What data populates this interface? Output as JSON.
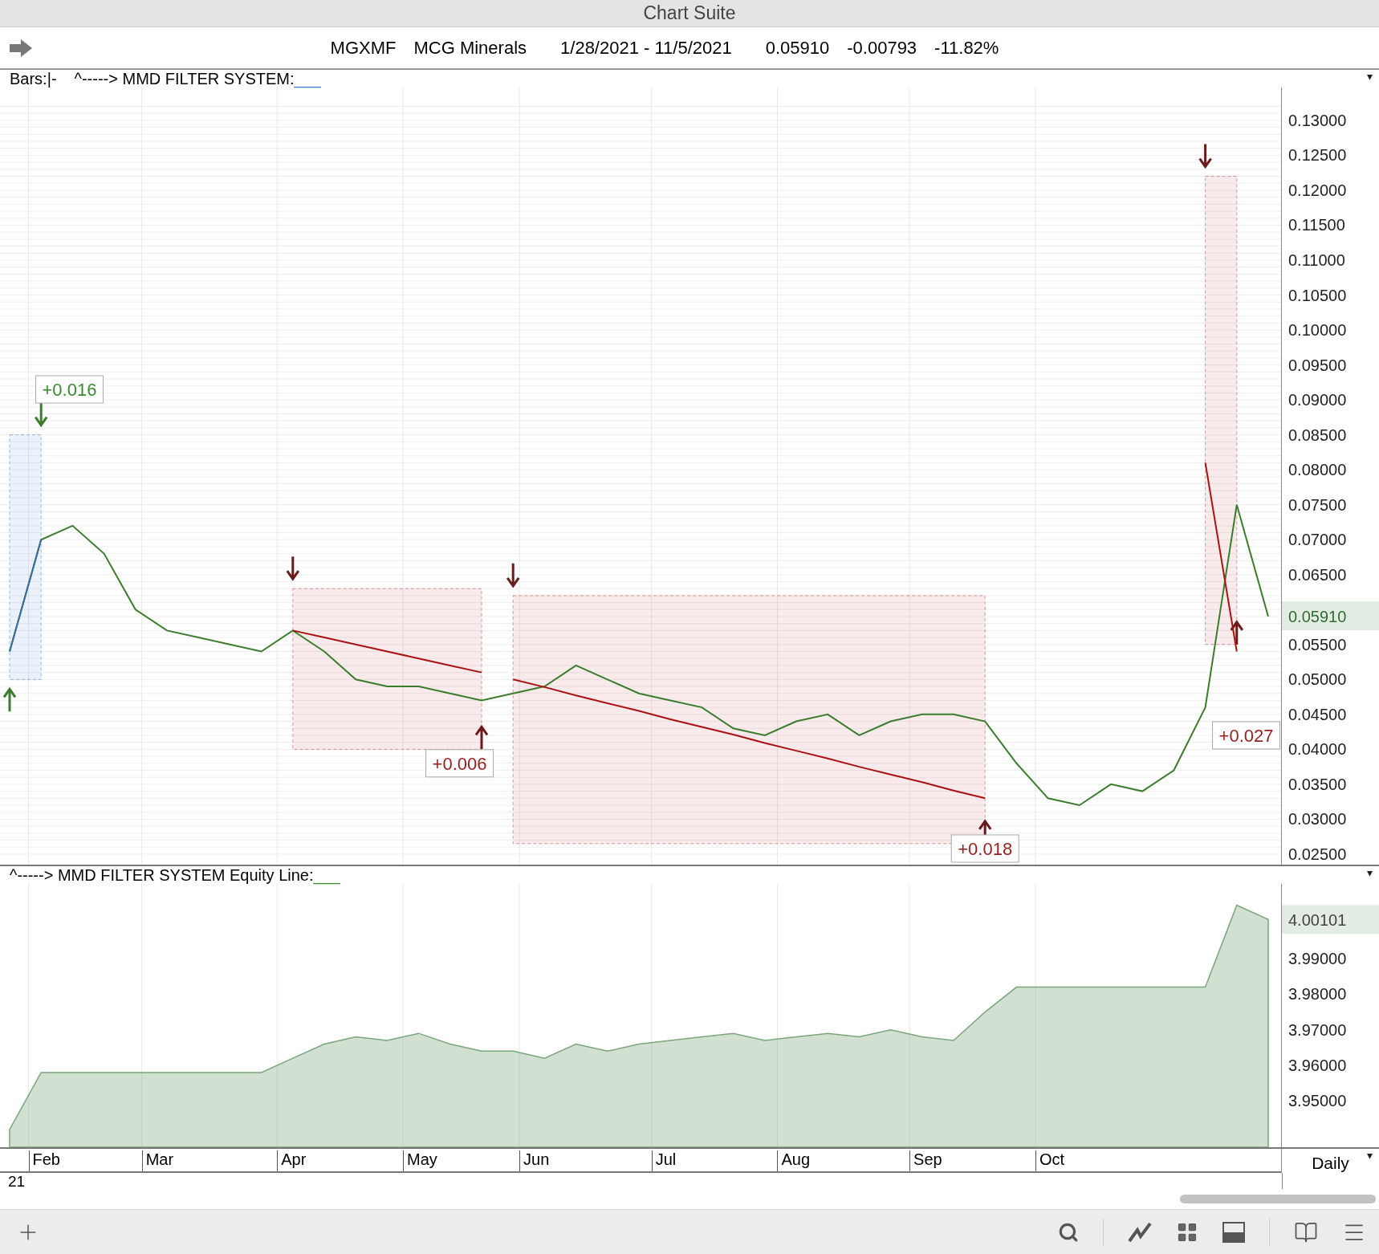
{
  "window": {
    "title": "Chart Suite"
  },
  "header": {
    "symbol": "MGXMF",
    "company": "MCG Minerals",
    "date_range": "1/28/2021 - 11/5/2021",
    "last": "0.05910",
    "change": "-0.00793",
    "change_pct": "-11.82%"
  },
  "price_pane": {
    "legend": {
      "bars_label": "Bars:",
      "bars_style": "|-",
      "system": "^-----> MMD FILTER SYSTEM:",
      "swatch": "___"
    },
    "menu_glyph": "▾",
    "current_value": "0.05910",
    "chart_data": {
      "type": "line",
      "grid": true,
      "series": [
        {
          "color": "#3a7d2c",
          "values": [
            0.054,
            0.07,
            0.072,
            0.068,
            0.06,
            0.057,
            0.056,
            0.055,
            0.054,
            0.057,
            0.054,
            0.05,
            0.049,
            0.049,
            0.048,
            0.047,
            0.048,
            0.049,
            0.052,
            0.05,
            0.048,
            0.047,
            0.046,
            0.043,
            0.042,
            0.044,
            0.045,
            0.042,
            0.044,
            0.045,
            0.045,
            0.044,
            0.038,
            0.033,
            0.032,
            0.035,
            0.034,
            0.037,
            0.046,
            0.075,
            0.059
          ]
        },
        {
          "color": "#3b6fa8",
          "values": [
            0.054,
            0.07,
            null,
            null,
            null,
            null,
            null,
            null,
            null,
            null,
            null,
            null,
            null,
            null,
            null,
            null,
            null,
            null,
            null,
            null,
            null,
            null,
            null,
            null,
            null,
            null,
            null,
            null,
            null,
            null,
            null,
            null,
            null,
            null,
            null,
            null,
            null,
            null,
            null,
            null,
            null
          ]
        },
        {
          "color": "#aa1111",
          "values": [
            null,
            null,
            null,
            null,
            null,
            null,
            null,
            null,
            null,
            0.057,
            0.056,
            0.055,
            0.054,
            0.053,
            0.052,
            0.051,
            null,
            null,
            null,
            null,
            null,
            null,
            null,
            null,
            null,
            null,
            null,
            null,
            null,
            null,
            null,
            null,
            null,
            null,
            null,
            null,
            null,
            null,
            null,
            null,
            null
          ]
        },
        {
          "color": "#aa1111",
          "values": [
            null,
            null,
            null,
            null,
            null,
            null,
            null,
            null,
            null,
            null,
            null,
            null,
            null,
            null,
            null,
            null,
            0.05,
            0.0489,
            0.0477,
            0.0466,
            0.0455,
            0.0443,
            0.0432,
            0.0421,
            0.0409,
            0.0398,
            0.0387,
            0.0375,
            0.0364,
            0.0353,
            0.0341,
            0.033,
            null,
            null,
            null,
            null,
            null,
            null,
            null,
            null,
            null
          ]
        },
        {
          "color": "#aa1111",
          "values": [
            null,
            null,
            null,
            null,
            null,
            null,
            null,
            null,
            null,
            null,
            null,
            null,
            null,
            null,
            null,
            null,
            null,
            null,
            null,
            null,
            null,
            null,
            null,
            null,
            null,
            null,
            null,
            null,
            null,
            null,
            null,
            null,
            null,
            null,
            null,
            null,
            null,
            null,
            0.081,
            0.054,
            null
          ]
        }
      ],
      "ylim": [
        0.0235,
        0.1347
      ],
      "yticks": [
        {
          "value": 0.025,
          "label": "0.02500"
        },
        {
          "value": 0.03,
          "label": "0.03000"
        },
        {
          "value": 0.035,
          "label": "0.03500"
        },
        {
          "value": 0.04,
          "label": "0.04000"
        },
        {
          "value": 0.045,
          "label": "0.04500"
        },
        {
          "value": 0.05,
          "label": "0.05000"
        },
        {
          "value": 0.055,
          "label": "0.05500"
        },
        {
          "value": 0.065,
          "label": "0.06500"
        },
        {
          "value": 0.07,
          "label": "0.07000"
        },
        {
          "value": 0.075,
          "label": "0.07500"
        },
        {
          "value": 0.08,
          "label": "0.08000"
        },
        {
          "value": 0.085,
          "label": "0.08500"
        },
        {
          "value": 0.09,
          "label": "0.09000"
        },
        {
          "value": 0.095,
          "label": "0.09500"
        },
        {
          "value": 0.1,
          "label": "0.10000"
        },
        {
          "value": 0.105,
          "label": "0.10500"
        },
        {
          "value": 0.11,
          "label": "0.11000"
        },
        {
          "value": 0.115,
          "label": "0.11500"
        },
        {
          "value": 0.12,
          "label": "0.12000"
        },
        {
          "value": 0.125,
          "label": "0.12500"
        },
        {
          "value": 0.13,
          "label": "0.13000"
        }
      ],
      "annotations": [
        "+0.016",
        "+0.006",
        "+0.018",
        "+0.027"
      ]
    }
  },
  "equity_pane": {
    "legend": {
      "system": "^-----> MMD FILTER SYSTEM Equity Line:",
      "swatch": "___"
    },
    "menu_glyph": "▾",
    "current_value": "4.00101",
    "chart_data": {
      "type": "area",
      "grid": true,
      "series": [
        {
          "color": "#7aa77a",
          "values": [
            3.942,
            3.958,
            3.958,
            3.958,
            3.958,
            3.958,
            3.958,
            3.958,
            3.958,
            3.962,
            3.966,
            3.968,
            3.967,
            3.969,
            3.966,
            3.964,
            3.964,
            3.962,
            3.966,
            3.964,
            3.966,
            3.967,
            3.968,
            3.969,
            3.967,
            3.968,
            3.969,
            3.968,
            3.97,
            3.968,
            3.967,
            3.975,
            3.982,
            3.982,
            3.982,
            3.982,
            3.982,
            3.982,
            3.982,
            4.005,
            4.001
          ]
        }
      ],
      "ylim": [
        3.937,
        4.011
      ],
      "yticks": [
        {
          "value": 3.95,
          "label": "3.95000"
        },
        {
          "value": 3.96,
          "label": "3.96000"
        },
        {
          "value": 3.97,
          "label": "3.97000"
        },
        {
          "value": 3.98,
          "label": "3.98000"
        },
        {
          "value": 3.99,
          "label": "3.99000"
        }
      ]
    }
  },
  "time_axis": {
    "months": [
      "Feb",
      "Mar",
      "Apr",
      "May",
      "Jun",
      "Jul",
      "Aug",
      "Sep",
      "Oct"
    ],
    "year": "21",
    "interval": "Daily",
    "menu_glyph": "▾"
  }
}
